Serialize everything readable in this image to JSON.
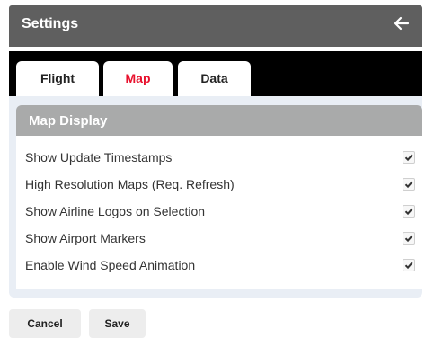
{
  "header": {
    "title": "Settings",
    "back_icon": "arrow-left-icon"
  },
  "tabs": [
    {
      "label": "Flight",
      "active": false
    },
    {
      "label": "Map",
      "active": true
    },
    {
      "label": "Data",
      "active": false
    }
  ],
  "section": {
    "title": "Map Display"
  },
  "options": [
    {
      "label": "Show Update Timestamps",
      "checked": true
    },
    {
      "label": "High Resolution Maps (Req. Refresh)",
      "checked": true
    },
    {
      "label": "Show Airline Logos on Selection",
      "checked": true
    },
    {
      "label": "Show Airport Markers",
      "checked": true
    },
    {
      "label": "Enable Wind Speed Animation",
      "checked": true
    }
  ],
  "footer": {
    "cancel_label": "Cancel",
    "save_label": "Save"
  },
  "colors": {
    "titlebar": "#5f5f5f",
    "tabstrip": "#000000",
    "active_tab_text": "#e8112d",
    "section_header": "#a9aaaa",
    "panel_bg": "#e9eef5"
  }
}
